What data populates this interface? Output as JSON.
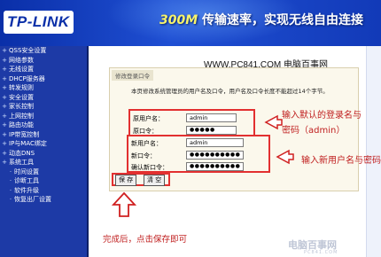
{
  "banner": {
    "logo": "TP-LINK",
    "slogan_highlight": "300M",
    "slogan_rest": " 传输速率，实现无线自由连接"
  },
  "sidebar": {
    "items": [
      {
        "label": "QSS安全设置",
        "sub": false
      },
      {
        "label": "网络参数",
        "sub": false
      },
      {
        "label": "无线设置",
        "sub": false
      },
      {
        "label": "DHCP服务器",
        "sub": false
      },
      {
        "label": "转发规则",
        "sub": false
      },
      {
        "label": "安全设置",
        "sub": false
      },
      {
        "label": "家长控制",
        "sub": false
      },
      {
        "label": "上网控制",
        "sub": false
      },
      {
        "label": "路由功能",
        "sub": false
      },
      {
        "label": "IP带宽控制",
        "sub": false
      },
      {
        "label": "IP与MAC绑定",
        "sub": false
      },
      {
        "label": "动态DNS",
        "sub": false
      },
      {
        "label": "系统工具",
        "sub": false
      },
      {
        "label": "时间设置",
        "sub": true
      },
      {
        "label": "诊断工具",
        "sub": true
      },
      {
        "label": "软件升级",
        "sub": true
      },
      {
        "label": "恢复出厂设置",
        "sub": true
      }
    ]
  },
  "site_url": "WWW.PC841.COM 电脑百事网",
  "panel": {
    "title": "修改登录口令",
    "description": "本页修改系统管理员的用户名及口令，用户名及口令长度不能超过14个字节。",
    "fields": {
      "old_user_label": "原用户名：",
      "old_user_value": "admin",
      "old_pass_label": "原口令：",
      "old_pass_value": "●●●●●",
      "new_user_label": "新用户名：",
      "new_user_value": "admin",
      "new_pass_label": "新口令：",
      "new_pass_value": "●●●●●●●●●●",
      "confirm_pass_label": "确认新口令：",
      "confirm_pass_value": "●●●●●●●●●●"
    },
    "save_label": "保 存",
    "clear_label": "清 空"
  },
  "annotations": {
    "old_line1": "输入默认的登录名与",
    "old_line2": "密码（admin）",
    "new_text": "输入新用户名与密码",
    "bottom_note": "完成后，点击保存即可"
  },
  "watermark": {
    "main": "电脑百事网",
    "sub": "PC841.COM"
  },
  "colors": {
    "banner": "#1f4fd3",
    "sidebar": "#1d3aa6",
    "highlight": "#e23030",
    "annotation_text": "#c02020"
  }
}
